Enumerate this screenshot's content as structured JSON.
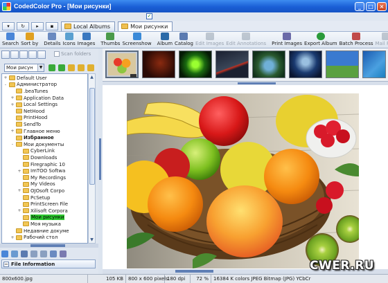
{
  "window": {
    "title": "CodedColor Pro - [Мои рисунки]"
  },
  "tabs": [
    {
      "label": "Local Albums"
    },
    {
      "label": "Мои рисунки"
    }
  ],
  "toolbar": {
    "items": [
      {
        "label": "Search",
        "icon": "search-icon"
      },
      {
        "label": "Sort by",
        "icon": "sort-icon"
      },
      {
        "label": "Details",
        "icon": "details-icon"
      },
      {
        "label": "Icons",
        "icon": "icons-view-icon"
      },
      {
        "label": "Images",
        "icon": "images-view-icon"
      },
      {
        "label": "Thumbs",
        "icon": "thumbs-icon"
      },
      {
        "label": "Screenshow",
        "icon": "screenshow-icon"
      },
      {
        "label": "Album",
        "icon": "album-icon"
      },
      {
        "label": "Catalog",
        "icon": "catalog-icon"
      },
      {
        "label": "Edit Images",
        "icon": "edit-images-icon",
        "disabled": true
      },
      {
        "label": "Edit Annotations",
        "icon": "edit-annotations-icon",
        "disabled": true
      },
      {
        "label": "Print Images",
        "icon": "print-icon"
      },
      {
        "label": "Export Album",
        "icon": "export-icon"
      },
      {
        "label": "Batch Process",
        "icon": "batch-icon"
      },
      {
        "label": "Mail Files",
        "icon": "mail-icon",
        "disabled": true
      }
    ]
  },
  "left_panel": {
    "scan_folders_label": "Scan folders",
    "path_value": "Мои рисун",
    "tree": [
      {
        "label": "Default User",
        "level": 3,
        "exp": "+"
      },
      {
        "label": "Администратор",
        "level": 3,
        "exp": "-"
      },
      {
        "label": ".beaTunes",
        "level": 4,
        "exp": ""
      },
      {
        "label": "Application Data",
        "level": 4,
        "exp": "+"
      },
      {
        "label": "Local Settings",
        "level": 4,
        "exp": "+"
      },
      {
        "label": "NetHood",
        "level": 4,
        "exp": ""
      },
      {
        "label": "PrintHood",
        "level": 4,
        "exp": ""
      },
      {
        "label": "SendTo",
        "level": 4,
        "exp": ""
      },
      {
        "label": "Главное меню",
        "level": 4,
        "exp": "+"
      },
      {
        "label": "Избранное",
        "level": 4,
        "exp": "",
        "bold": true
      },
      {
        "label": "Мои документы",
        "level": 4,
        "exp": "-"
      },
      {
        "label": "CyberLink",
        "level": 5,
        "exp": ""
      },
      {
        "label": "Downloads",
        "level": 5,
        "exp": ""
      },
      {
        "label": "Firegraphic 10",
        "level": 5,
        "exp": ""
      },
      {
        "label": "ImTOO Softwa",
        "level": 5,
        "exp": "+"
      },
      {
        "label": "My Recordings",
        "level": 5,
        "exp": ""
      },
      {
        "label": "My Videos",
        "level": 5,
        "exp": ""
      },
      {
        "label": "OJOsoft Corpo",
        "level": 5,
        "exp": "+"
      },
      {
        "label": "PcSetup",
        "level": 5,
        "exp": ""
      },
      {
        "label": "PrintScreen File",
        "level": 5,
        "exp": ""
      },
      {
        "label": "Xilisoft Corpora",
        "level": 5,
        "exp": "+"
      },
      {
        "label": "Мои рисунки",
        "level": 5,
        "exp": "",
        "selected": true
      },
      {
        "label": "Моя музыка",
        "level": 5,
        "exp": ""
      },
      {
        "label": "Недавние докуме",
        "level": 4,
        "exp": ""
      },
      {
        "label": "Рабочий стол",
        "level": 4,
        "exp": "+"
      }
    ],
    "file_info_label": "File Information"
  },
  "status": {
    "filename": "800x600.jpg",
    "size": "105 KB",
    "dims": "800 x 600 pixels",
    "dpi": "180 dpi",
    "zoom": "72 %",
    "info": "16384 K colors JPEG Bitmap (JPG) YCbCr"
  },
  "watermark": "CWER.RU",
  "colors": {
    "title_bar": "#1a5fd6",
    "selected_tree": "#2ec830",
    "status_bar": "#e4e8ee"
  }
}
